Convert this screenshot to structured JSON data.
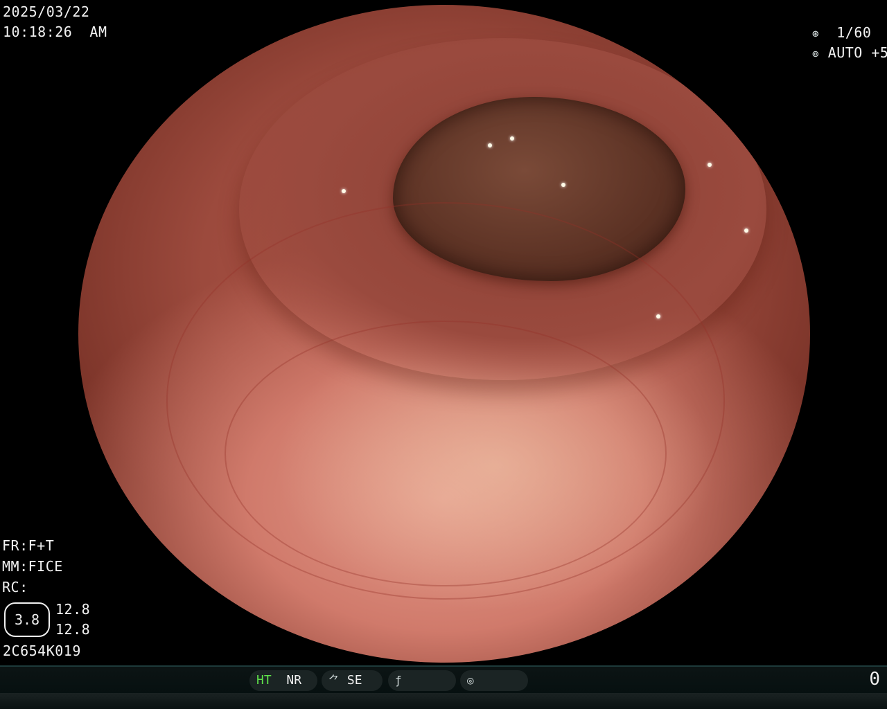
{
  "overlay": {
    "date": "2025/03/22",
    "time": "10:18:26",
    "ampm": "AM",
    "shutter": "1/60",
    "exposure": "AUTO +5",
    "fr": "FR:F+T",
    "mm": "MM:FICE",
    "rc": "RC:",
    "iris_value": "3.8",
    "value_top": "12.8",
    "value_bottom": "12.8",
    "scope_id": "2C654K019"
  },
  "status_bar": {
    "ht": "HT",
    "nr": "NR",
    "se": "SE",
    "counter": "0"
  },
  "icons": {
    "shutter": "aperture-icon",
    "exposure": "iris-icon",
    "se": "structure-enhance-icon",
    "filter": "filter-icon",
    "mode": "mode-icon"
  }
}
